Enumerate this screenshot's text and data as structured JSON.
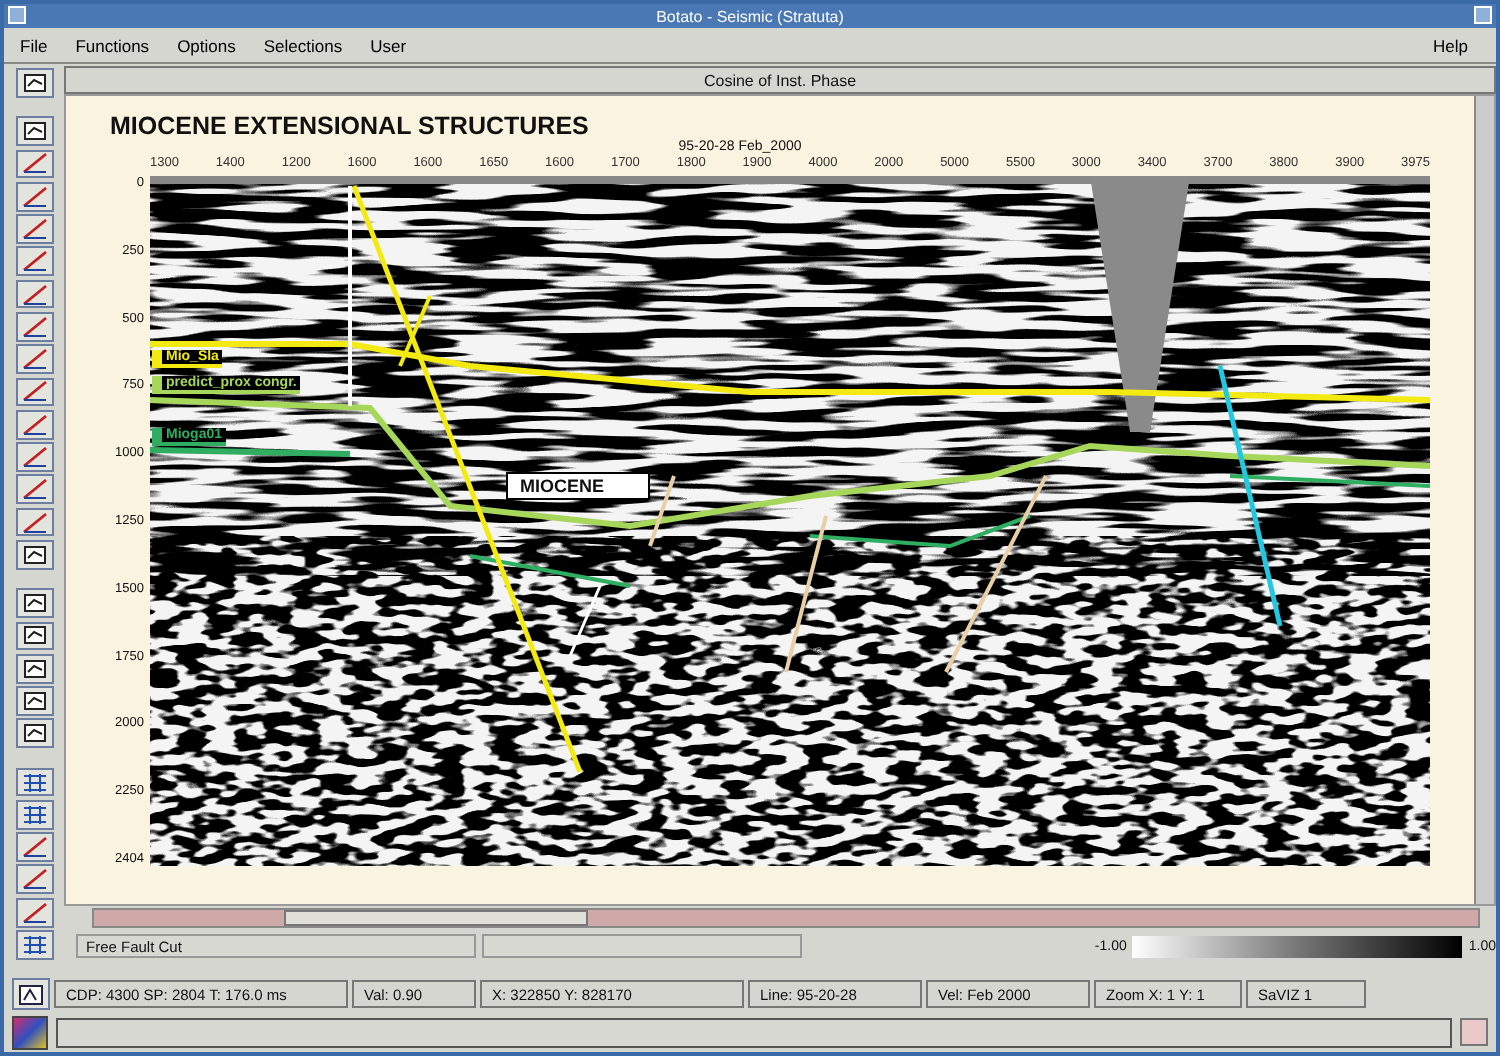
{
  "window": {
    "title": "Botato - Seismic (Stratuta)"
  },
  "menu": [
    {
      "label": "File"
    },
    {
      "label": "Functions"
    },
    {
      "label": "Options"
    },
    {
      "label": "Selections"
    },
    {
      "label": "User"
    }
  ],
  "help": "Help",
  "panel": {
    "title": "Cosine of Inst. Phase"
  },
  "section": {
    "title": "MIOCENE EXTENSIONAL STRUCTURES",
    "line_label": "95-20-28 Feb_2000",
    "x_ticks": [
      "1300",
      "1400",
      "1200",
      "1600",
      "1600",
      "1650",
      "1600",
      "1700",
      "1800",
      "1900",
      "4000",
      "2000",
      "5000",
      "5500",
      "3000",
      "3400",
      "3700",
      "3800",
      "3900",
      "3975"
    ],
    "y_ticks": [
      "0",
      "250",
      "500",
      "750",
      "1000",
      "1250",
      "1500",
      "1750",
      "2000",
      "2250",
      "2404"
    ],
    "annotation": "MIOCENE",
    "horizons": [
      {
        "label": "Mio_Sla",
        "color": "#f2ea10"
      },
      {
        "label": "predict_prox congr.",
        "color": "#a6d65a"
      },
      {
        "label": "Mioga01",
        "color": "#2fae62"
      }
    ],
    "faults": [
      {
        "color": "#f2ea10"
      },
      {
        "color": "#e8cfa8"
      },
      {
        "color": "#22c8e0"
      },
      {
        "color": "#ffffff"
      }
    ]
  },
  "fault_field": "Free Fault Cut",
  "colorbar": {
    "min": "-1.00",
    "max": "1.00"
  },
  "status": [
    "CDP: 4300 SP: 2804 T: 176.0 ms",
    "Val: 0.90",
    "X: 322850 Y: 828170",
    "Line: 95-20-28",
    "Vel: Feb 2000",
    "Zoom X: 1 Y: 1",
    "SaVIZ 1"
  ]
}
